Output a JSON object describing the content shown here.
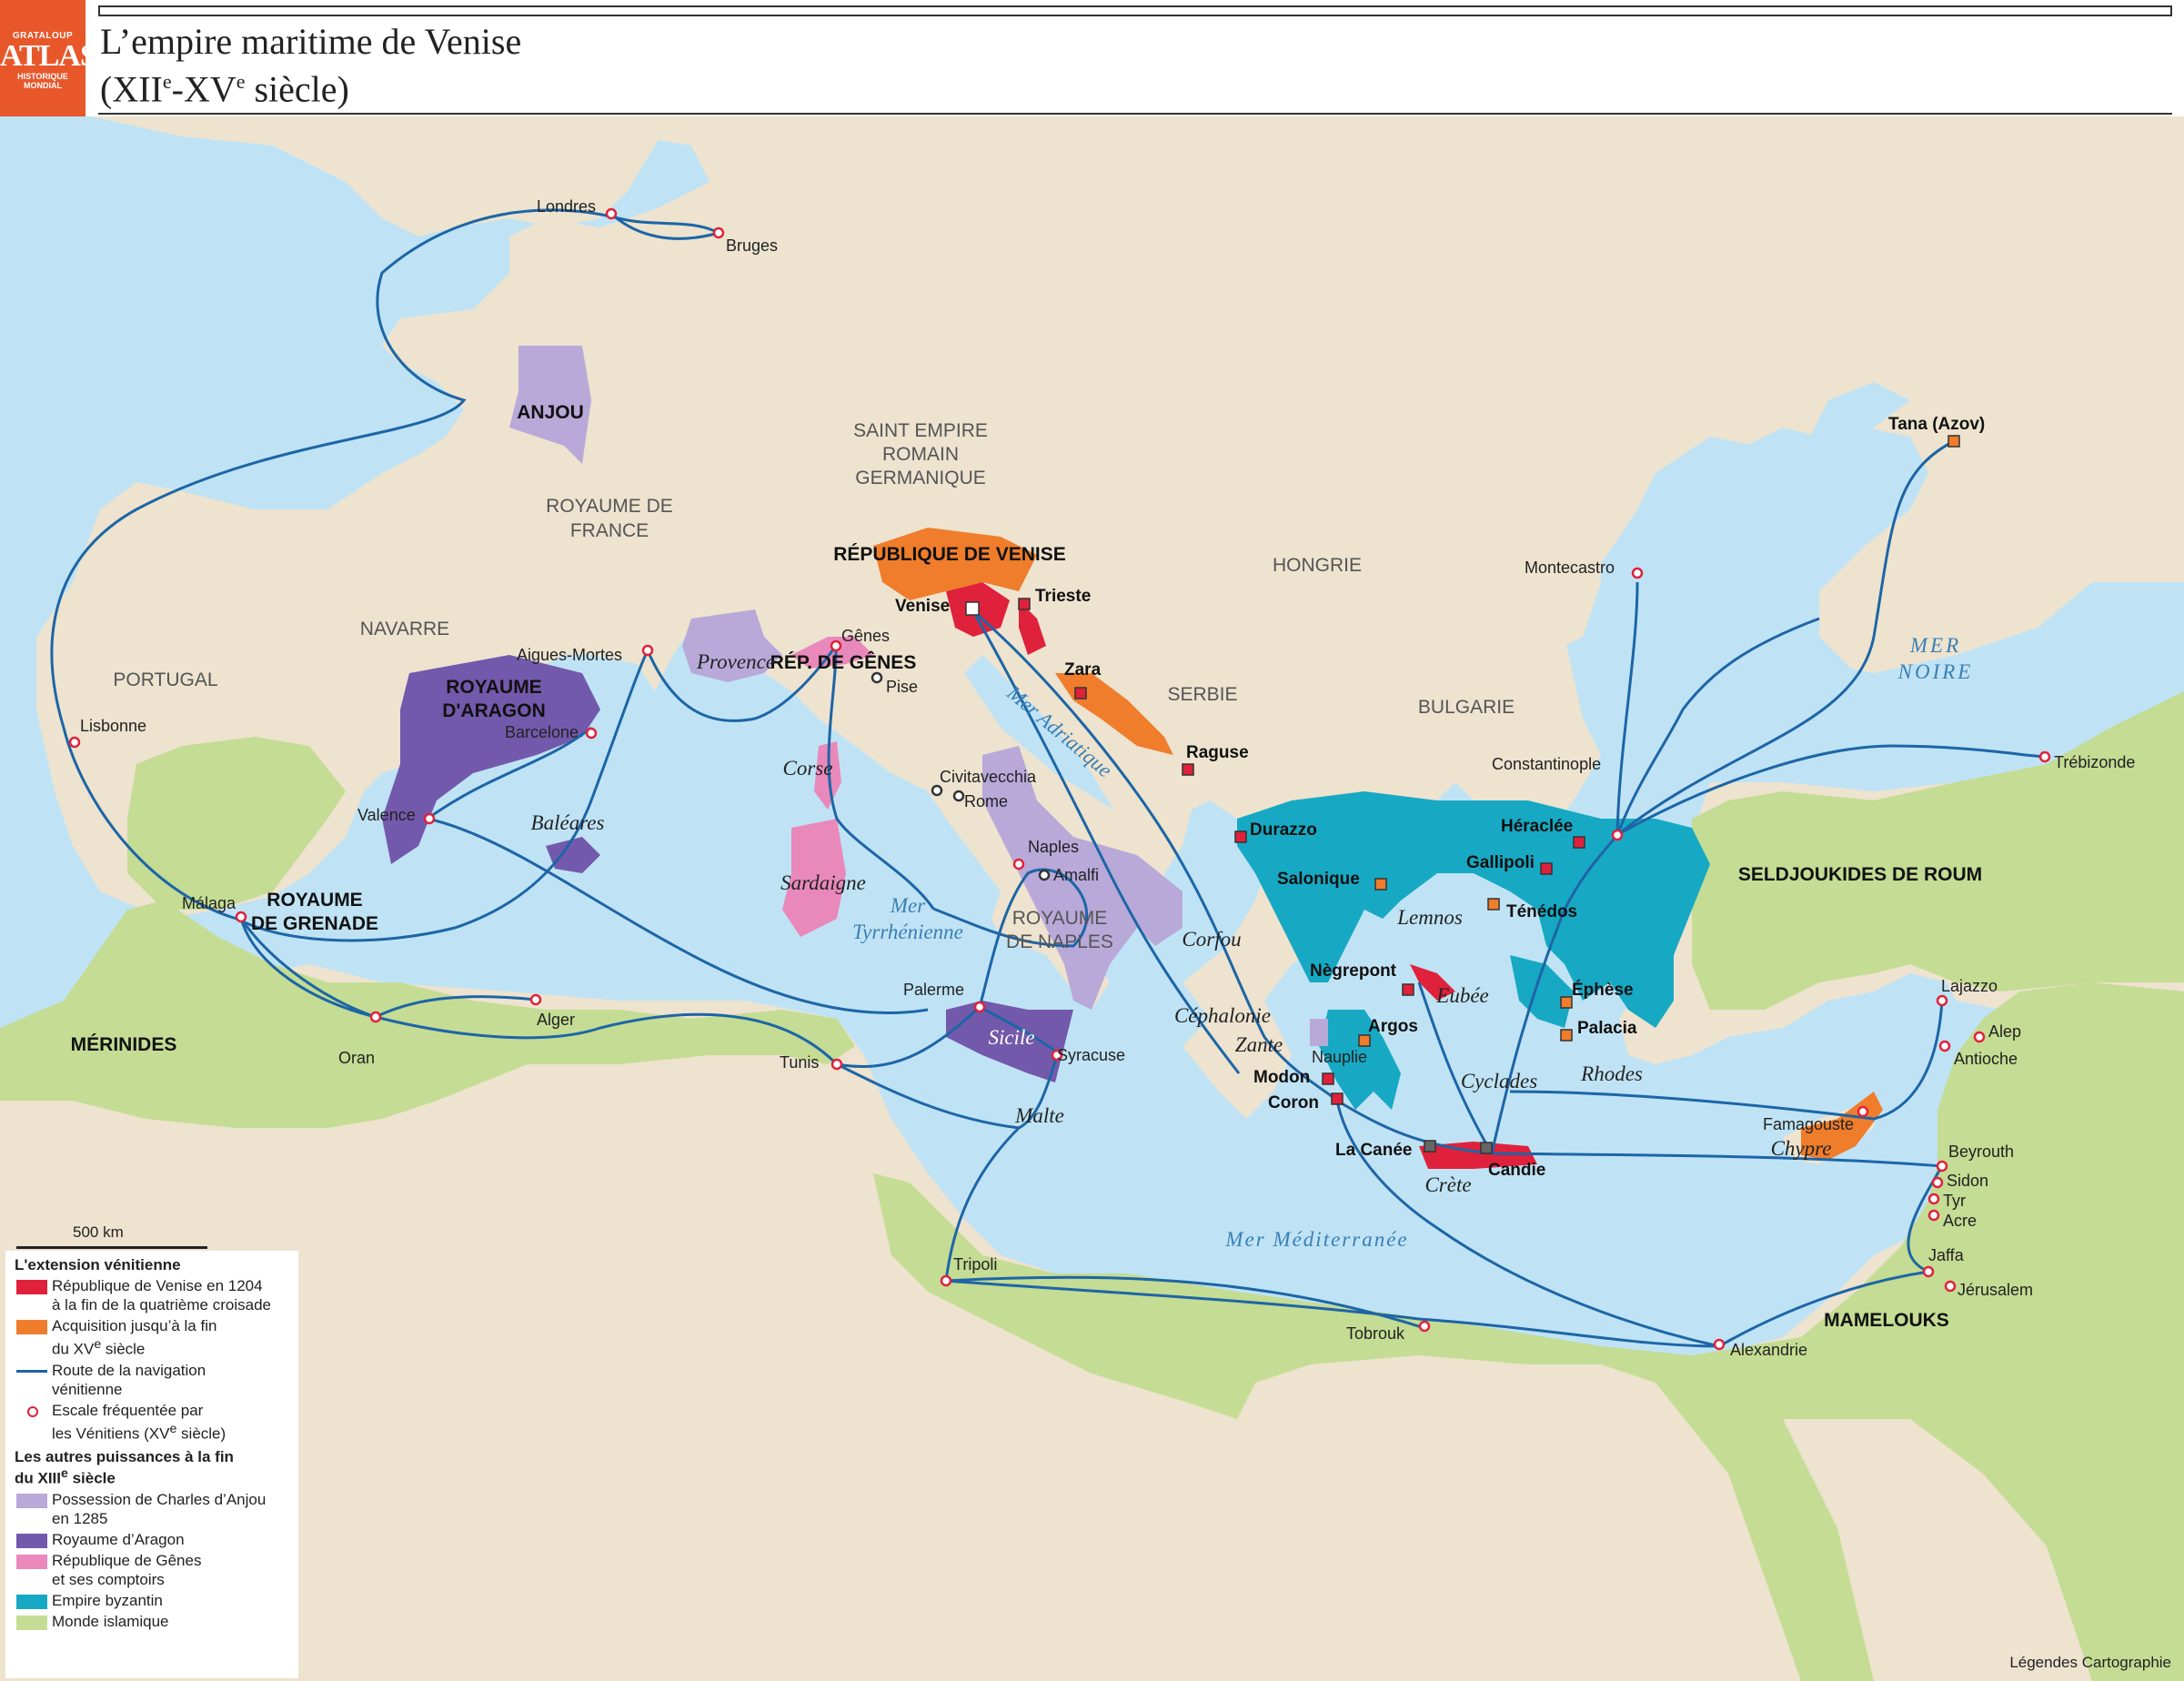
{
  "header": {
    "logo_top": "GRATALOUP",
    "logo_main": "ATLAS",
    "logo_sub1": "HISTORIQUE",
    "logo_sub2": "MONDIAL",
    "title_line1": "L’empire maritime de Venise",
    "title_line2": "(XIIe-XVe siècle)"
  },
  "colors": {
    "sea": "#bfe3f5",
    "land": "#ede3cf",
    "islamic": "#c4dc93",
    "byzantine": "#17a9c4",
    "venice_1204": "#e0213b",
    "venice_acq": "#ef7d2c",
    "anjou": "#b8a9d9",
    "aragon": "#7359ac",
    "genoa": "#e989bb",
    "route": "#1d65a6"
  },
  "regions": {
    "anjou": "ANJOU",
    "france": "ROYAUME DE FRANCE",
    "hre": "SAINT EMPIRE ROMAIN GERMANIQUE",
    "navarre": "NAVARRE",
    "portugal": "PORTUGAL",
    "aragon": "ROYAUME D'ARAGON",
    "grenade": "ROYAUME DE GRENADE",
    "merinides": "MÉRINIDES",
    "venise": "RÉPUBLIQUE DE VENISE",
    "genes": "RÉP. DE GÊNES",
    "hongrie": "HONGRIE",
    "serbie": "SERBIE",
    "bulgarie": "BULGARIE",
    "naples": "ROYAUME DE NAPLES",
    "seldjoukides": "SELDJOUKIDES DE ROUM",
    "mamelouks": "MAMELOUKS"
  },
  "seas": {
    "noire1": "MER",
    "noire2": "NOIRE",
    "adriatique": "Mer Adriatique",
    "tyrrhenienne1": "Mer",
    "tyrrhenienne2": "Tyrrhénienne",
    "mediterranee": "Mer Méditerranée"
  },
  "islands": {
    "provence": "Provence",
    "baleares": "Baléares",
    "corse": "Corse",
    "sardaigne": "Sardaigne",
    "sicile": "Sicile",
    "malte": "Malte",
    "corfou": "Corfou",
    "cephalonie": "Céphalonie",
    "zante": "Zante",
    "lemnos": "Lemnos",
    "eubee": "Eubée",
    "cyclades": "Cyclades",
    "rhodes": "Rhodes",
    "crete": "Crète",
    "chypre": "Chypre"
  },
  "ports": {
    "londres": "Londres",
    "bruges": "Bruges",
    "lisbonne": "Lisbonne",
    "aigues": "Aigues-Mortes",
    "barcelone": "Barcelone",
    "valence": "Valence",
    "malaga": "Málaga",
    "oran": "Oran",
    "alger": "Alger",
    "tunis": "Tunis",
    "genes": "Gênes",
    "pise": "Pise",
    "civita": "Civitavecchia",
    "rome": "Rome",
    "naples": "Naples",
    "amalfi": "Amalfi",
    "palerme": "Palerme",
    "syracuse": "Syracuse",
    "tripoli": "Tripoli",
    "tobrouk": "Tobrouk",
    "alexandrie": "Alexandrie",
    "jaffa": "Jaffa",
    "jerusalem": "Jérusalem",
    "acre": "Acre",
    "tyr": "Tyr",
    "sidon": "Sidon",
    "beyrouth": "Beyrouth",
    "famagouste": "Famagouste",
    "antioche": "Antioche",
    "alep": "Alep",
    "lajazzo": "Lajazzo",
    "trebizonde": "Trébizonde",
    "constantinople": "Constantinople",
    "montecastro": "Montecastro",
    "nauplie": "Nauplie"
  },
  "venetian": {
    "venise": "Venise",
    "trieste": "Trieste",
    "zara": "Zara",
    "raguse": "Raguse",
    "durazzo": "Durazzo",
    "salonique": "Salonique",
    "gallipoli": "Gallipoli",
    "heraclee": "Héraclée",
    "tenedos": "Ténédos",
    "negrepont": "Nègrepont",
    "argos": "Argos",
    "modon": "Modon",
    "coron": "Coron",
    "canee": "La Canée",
    "candie": "Candie",
    "ephese": "Éphèse",
    "palacia": "Palacia",
    "tana": "Tana (Azov)"
  },
  "legend": {
    "scale": "500 km",
    "h1": "L'extension vénitienne",
    "v1204_a": "République de Venise en 1204",
    "v1204_b": "à la fin de la quatrième croisade",
    "acq_a": "Acquisition jusqu’à la fin",
    "acq_b": "du XVe siècle",
    "route_a": "Route de la navigation",
    "route_b": "vénitienne",
    "escale_a": "Escale fréquentée par",
    "escale_b": "les Vénitiens (XVe siècle)",
    "h2a": "Les autres puissances à la fin",
    "h2b": "du XIIIe siècle",
    "anjou_a": "Possession de Charles d’Anjou",
    "anjou_b": "en 1285",
    "aragon": "Royaume d’Aragon",
    "genes_a": "République de Gênes",
    "genes_b": "et ses comptoirs",
    "byz": "Empire byzantin",
    "islam": "Monde islamique"
  },
  "credit": "Légendes Cartographie"
}
